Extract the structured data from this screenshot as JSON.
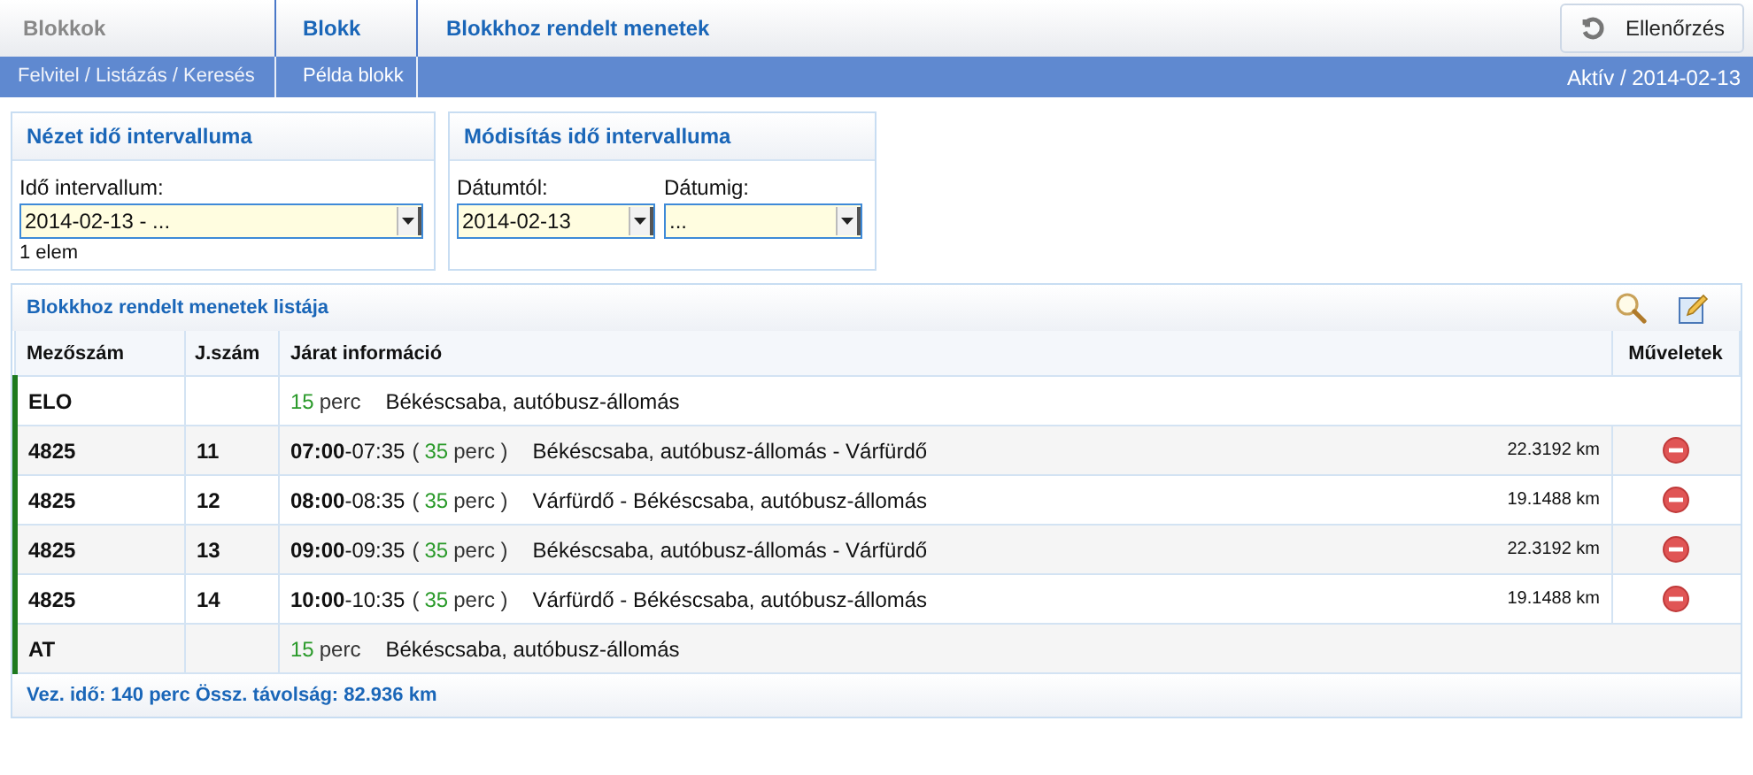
{
  "breadcrumbs": [
    {
      "title": "Blokkok",
      "subtitle": "Felvitel / Listázás / Keresés",
      "selected": false
    },
    {
      "title": "Blokk",
      "subtitle": "Példa blokk",
      "selected": true
    },
    {
      "title": "Blokkhoz rendelt menetek",
      "selected": true
    }
  ],
  "check_button": {
    "label": "Ellenőrzés"
  },
  "status": "Aktív / 2014-02-13",
  "view_panel": {
    "title": "Nézet idő intervalluma",
    "label": "Idő intervallum:",
    "value": "2014-02-13 - ...",
    "count": "1 elem"
  },
  "modify_panel": {
    "title": "Módisítás idő intervalluma",
    "from_label": "Dátumtól:",
    "from_value": "2014-02-13",
    "to_label": "Dátumig:",
    "to_value": "..."
  },
  "list": {
    "title": "Blokkhoz rendelt menetek listája",
    "columns": [
      "Mezőszám",
      "J.szám",
      "Járat információ",
      "Műveletek"
    ],
    "rows": [
      {
        "kind": "terminal",
        "field": "ELO",
        "duration": "15",
        "unit": "perc",
        "place": "Békéscsaba, autóbusz-állomás"
      },
      {
        "kind": "trip",
        "field": "4825",
        "number": "11",
        "start": "07:00",
        "end": "-07:35",
        "open": "(",
        "duration": "35",
        "unit": "perc )",
        "route": "Békéscsaba, autóbusz-állomás - Várfürdő",
        "distance": "22.3192 km"
      },
      {
        "kind": "trip",
        "field": "4825",
        "number": "12",
        "start": "08:00",
        "end": "-08:35",
        "open": "(",
        "duration": "35",
        "unit": "perc )",
        "route": "Várfürdő - Békéscsaba, autóbusz-állomás",
        "distance": "19.1488 km"
      },
      {
        "kind": "trip",
        "field": "4825",
        "number": "13",
        "start": "09:00",
        "end": "-09:35",
        "open": "(",
        "duration": "35",
        "unit": "perc )",
        "route": "Békéscsaba, autóbusz-állomás - Várfürdő",
        "distance": "22.3192 km"
      },
      {
        "kind": "trip",
        "field": "4825",
        "number": "14",
        "start": "10:00",
        "end": "-10:35",
        "open": "(",
        "duration": "35",
        "unit": "perc )",
        "route": "Várfürdő - Békéscsaba, autóbusz-állomás",
        "distance": "19.1488 km"
      },
      {
        "kind": "terminal",
        "field": "AT",
        "duration": "15",
        "unit": "perc",
        "place": "Békéscsaba, autóbusz-állomás"
      }
    ],
    "summary": "Vez. idő: 140 perc Össz. távolság: 82.936 km"
  }
}
